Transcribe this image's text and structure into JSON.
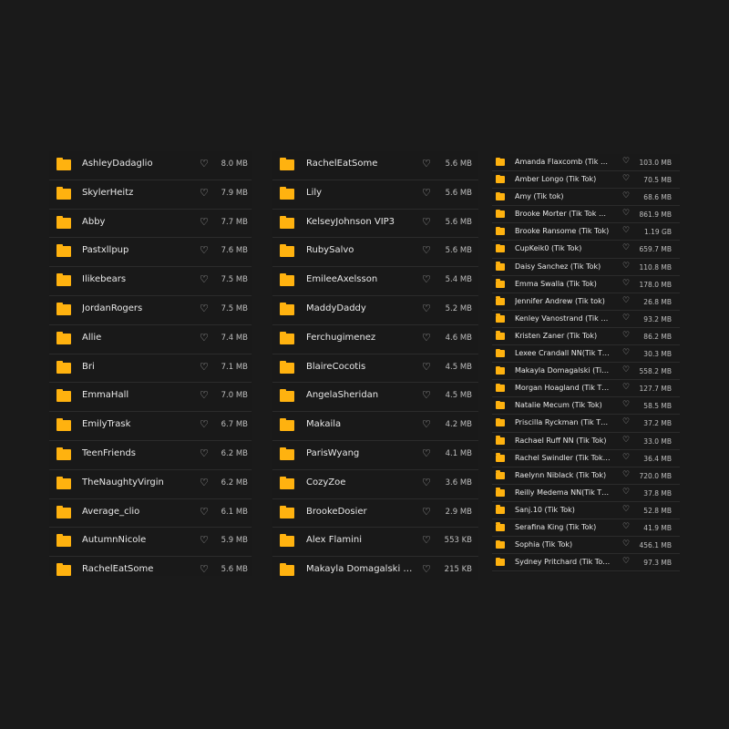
{
  "colors": {
    "folder": "#ffb20f",
    "background": "#1a1a1a"
  },
  "columns": [
    {
      "items": [
        {
          "name": "AshleyDadaglio",
          "size": "8.0 MB"
        },
        {
          "name": "SkylerHeitz",
          "size": "7.9 MB"
        },
        {
          "name": "Abby",
          "size": "7.7 MB"
        },
        {
          "name": "Pastxllpup",
          "size": "7.6 MB"
        },
        {
          "name": "Ilikebears",
          "size": "7.5 MB"
        },
        {
          "name": "JordanRogers",
          "size": "7.5 MB"
        },
        {
          "name": "Allie",
          "size": "7.4 MB"
        },
        {
          "name": "Bri",
          "size": "7.1 MB"
        },
        {
          "name": "EmmaHall",
          "size": "7.0 MB"
        },
        {
          "name": "EmilyTrask",
          "size": "6.7 MB"
        },
        {
          "name": "TeenFriends",
          "size": "6.2 MB"
        },
        {
          "name": "TheNaughtyVirgin",
          "size": "6.2 MB"
        },
        {
          "name": "Average_clio",
          "size": "6.1 MB"
        },
        {
          "name": "AutumnNicole",
          "size": "5.9 MB"
        },
        {
          "name": "RachelEatSome",
          "size": "5.6 MB"
        }
      ]
    },
    {
      "items": [
        {
          "name": "RachelEatSome",
          "size": "5.6 MB"
        },
        {
          "name": "Lily",
          "size": "5.6 MB"
        },
        {
          "name": "KelseyJohnson VIP3",
          "size": "5.6 MB"
        },
        {
          "name": "RubySalvo",
          "size": "5.6 MB"
        },
        {
          "name": "EmileeAxelsson",
          "size": "5.4 MB"
        },
        {
          "name": "MaddyDaddy",
          "size": "5.2 MB"
        },
        {
          "name": "Ferchugimenez",
          "size": "4.6 MB"
        },
        {
          "name": "BlaireCocotis",
          "size": "4.5 MB"
        },
        {
          "name": "AngelaSheridan",
          "size": "4.5 MB"
        },
        {
          "name": "Makaila",
          "size": "4.2 MB"
        },
        {
          "name": "ParisWyang",
          "size": "4.1 MB"
        },
        {
          "name": "CozyZoe",
          "size": "3.6 MB"
        },
        {
          "name": "BrookeDosier",
          "size": "2.9 MB"
        },
        {
          "name": "Alex Flamini",
          "size": "553 KB"
        },
        {
          "name": "Makayla Domagalski (T…",
          "size": "215 KB"
        }
      ]
    },
    {
      "items": [
        {
          "name": "Amanda Flaxcomb (Tik …",
          "size": "103.0 MB"
        },
        {
          "name": "Amber Longo (Tik Tok)",
          "size": "70.5 MB"
        },
        {
          "name": "Amy (Tik tok)",
          "size": "68.6 MB"
        },
        {
          "name": "Brooke Morter (Tik Tok …",
          "size": "861.9 MB"
        },
        {
          "name": "Brooke Ransome (Tik Tok)",
          "size": "1.19 GB"
        },
        {
          "name": "CupKeik0 (Tik Tok)",
          "size": "659.7 MB"
        },
        {
          "name": "Daisy Sanchez (Tik Tok)",
          "size": "110.8 MB"
        },
        {
          "name": "Emma Swalla (Tik Tok)",
          "size": "178.0 MB"
        },
        {
          "name": "Jennifer Andrew (Tik tok)",
          "size": "26.8 MB"
        },
        {
          "name": "Kenley Vanostrand (Tik …",
          "size": "93.2 MB"
        },
        {
          "name": "Kristen Zaner (Tik Tok)",
          "size": "86.2 MB"
        },
        {
          "name": "Lexee Crandall NN(Tik T…",
          "size": "30.3 MB"
        },
        {
          "name": "Makayla Domagalski (Ti…",
          "size": "558.2 MB"
        },
        {
          "name": "Morgan Hoagland (Tik T…",
          "size": "127.7 MB"
        },
        {
          "name": "Natalie Mecum (Tik Tok)",
          "size": "58.5 MB"
        },
        {
          "name": "Priscilla Ryckman (Tik T…",
          "size": "37.2 MB"
        },
        {
          "name": "Rachael Ruff NN (Tik Tok)",
          "size": "33.0 MB"
        },
        {
          "name": "Rachel Swindler (Tik Tok…",
          "size": "36.4 MB"
        },
        {
          "name": "Raelynn Niblack (Tik Tok)",
          "size": "720.0 MB"
        },
        {
          "name": "Reilly Medema NN(Tik T…",
          "size": "37.8 MB"
        },
        {
          "name": "Sanj.10 (Tik Tok)",
          "size": "52.8 MB"
        },
        {
          "name": "Serafina King (Tik Tok)",
          "size": "41.9 MB"
        },
        {
          "name": "Sophia (Tik Tok)",
          "size": "456.1 MB"
        },
        {
          "name": "Sydney Pritchard (Tik To…",
          "size": "97.3 MB"
        }
      ]
    }
  ]
}
